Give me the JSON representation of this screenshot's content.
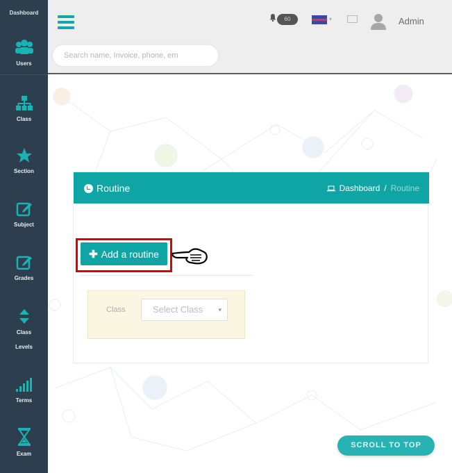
{
  "sidebar": {
    "top_label": "Dashboard",
    "items": [
      {
        "label": "Users",
        "icon": "users-icon"
      },
      {
        "label": "Class",
        "icon": "sitemap-icon"
      },
      {
        "label": "Section",
        "icon": "star-icon"
      },
      {
        "label": "Subject",
        "icon": "edit-icon"
      },
      {
        "label": "Grades",
        "icon": "edit-icon"
      },
      {
        "label": "Class",
        "label2": "Levels",
        "icon": "sort-icon"
      },
      {
        "label": "Terms",
        "icon": "signal-bars-icon"
      },
      {
        "label": "Exam",
        "icon": "hourglass-icon"
      }
    ]
  },
  "header": {
    "search_placeholder": "Search name, Invoice, phone, em",
    "notification_count": "60",
    "user_name": "Admin"
  },
  "card": {
    "title": "Routine",
    "breadcrumb": {
      "home": "Dashboard",
      "separator": "/",
      "current": "Routine"
    },
    "add_button_label": "Add a routine",
    "filter": {
      "label": "Class",
      "select_value": "Select Class"
    }
  },
  "scroll_top_label": "SCROLL TO TOP",
  "colors": {
    "accent": "#0fa5a5",
    "sidebar": "#2d3e4e",
    "highlight": "#e00000"
  }
}
